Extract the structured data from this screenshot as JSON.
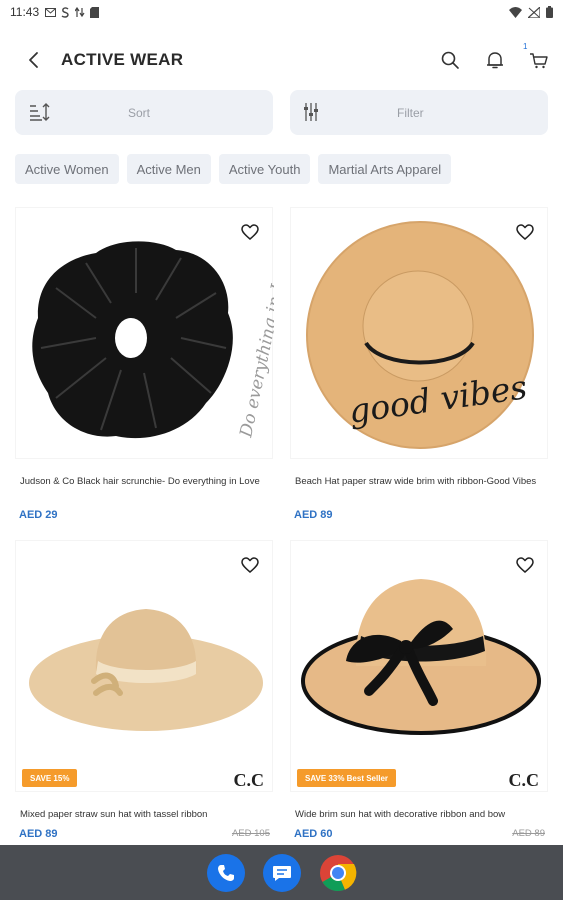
{
  "status": {
    "time": "11:43",
    "icons": [
      "mail-icon",
      "s-icon",
      "data-icon",
      "storage-icon"
    ],
    "right_icons": [
      "wifi-icon",
      "signal-icon",
      "battery-icon"
    ]
  },
  "header": {
    "title": "ACTIVE WEAR",
    "cart_count": "1"
  },
  "sort": {
    "label": "Sort"
  },
  "filter": {
    "label": "Filter"
  },
  "chips": [
    "Active Women",
    "Active Men",
    "Active Youth",
    "Martial Arts Apparel"
  ],
  "products": [
    {
      "name": "Judson & Co Black hair scrunchie- Do everything in Love",
      "price": "AED 29",
      "old_price": "",
      "badge": "",
      "brand": "",
      "image_text": "Do everything in Lo"
    },
    {
      "name": "Beach Hat paper straw wide brim with ribbon-Good Vibes",
      "price": "AED 89",
      "old_price": "",
      "badge": "",
      "brand": "",
      "image_text": "good vibes"
    },
    {
      "name": "Mixed paper straw sun hat with tassel ribbon",
      "price": "AED 89",
      "old_price": "AED 105",
      "badge": "SAVE 15%",
      "brand": "C.C",
      "image_text": ""
    },
    {
      "name": "Wide brim sun hat with decorative ribbon and bow",
      "price": "AED 60",
      "old_price": "AED 89",
      "badge": "SAVE 33% Best Seller",
      "brand": "C.C",
      "image_text": ""
    }
  ],
  "colors": {
    "accent": "#2f72c4",
    "badge": "#f59b2b",
    "chip_bg": "#eef1f6",
    "navbar": "#4a4d52"
  },
  "dock": [
    "phone-app-icon",
    "messages-app-icon",
    "chrome-app-icon"
  ]
}
